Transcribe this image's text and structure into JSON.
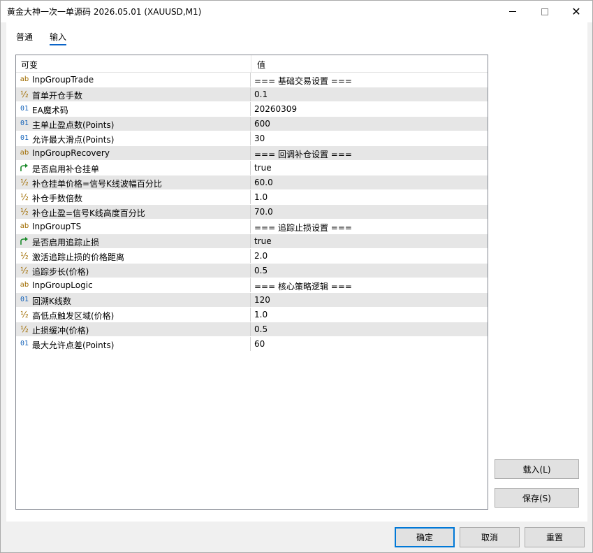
{
  "window": {
    "title": "黄金大神一次一单源码 2026.05.01 (XAUUSD,M1)",
    "close_glyph": "✕"
  },
  "tabs": [
    {
      "label": "普通"
    },
    {
      "label": "输入",
      "active": true
    }
  ],
  "grid": {
    "col_variable": "可变",
    "col_value": "值",
    "rows": [
      {
        "icon": "ab",
        "name": "InpGroupTrade",
        "value": "=== 基础交易设置 ==="
      },
      {
        "icon": "½",
        "name": "首单开仓手数",
        "value": "0.1"
      },
      {
        "icon": "01",
        "name": "EA魔术码",
        "value": "20260309"
      },
      {
        "icon": "01",
        "name": "主单止盈点数(Points)",
        "value": "600"
      },
      {
        "icon": "01",
        "name": "允许最大滑点(Points)",
        "value": "30"
      },
      {
        "icon": "ab",
        "name": "InpGroupRecovery",
        "value": "=== 回调补仓设置 ==="
      },
      {
        "icon": "bool",
        "name": "是否启用补仓挂单",
        "value": "true"
      },
      {
        "icon": "½",
        "name": "补仓挂单价格=信号K线波幅百分比",
        "value": "60.0"
      },
      {
        "icon": "½",
        "name": "补仓手数倍数",
        "value": "1.0"
      },
      {
        "icon": "½",
        "name": "补仓止盈=信号K线高度百分比",
        "value": "70.0"
      },
      {
        "icon": "ab",
        "name": "InpGroupTS",
        "value": "=== 追踪止损设置 ==="
      },
      {
        "icon": "bool",
        "name": "是否启用追踪止损",
        "value": "true"
      },
      {
        "icon": "½",
        "name": "激活追踪止损的价格距离",
        "value": "2.0"
      },
      {
        "icon": "½",
        "name": "追踪步长(价格)",
        "value": "0.5"
      },
      {
        "icon": "ab",
        "name": "InpGroupLogic",
        "value": "=== 核心策略逻辑 ==="
      },
      {
        "icon": "01",
        "name": "回溯K线数",
        "value": "120"
      },
      {
        "icon": "½",
        "name": "高低点触发区域(价格)",
        "value": "1.0"
      },
      {
        "icon": "½",
        "name": "止损缓冲(价格)",
        "value": "0.5"
      },
      {
        "icon": "01",
        "name": "最大允许点差(Points)",
        "value": "60"
      }
    ]
  },
  "buttons": {
    "load": "载入(L)",
    "save": "保存(S)",
    "ok": "确定",
    "cancel": "取消",
    "reset": "重置"
  },
  "colors": {
    "accent": "#0078d7",
    "row_alt": "#e6e6e6",
    "icon_int": "#1060b8",
    "icon_str": "#a06c00",
    "icon_bool": "#1a8a2a"
  }
}
